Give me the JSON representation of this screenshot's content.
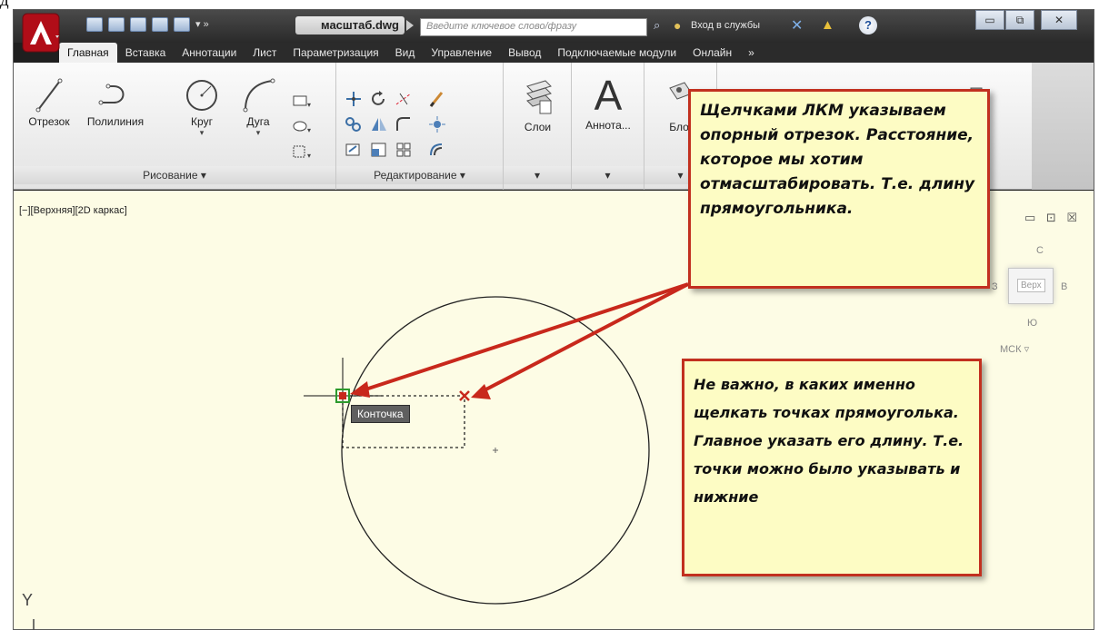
{
  "page_text_fragment": "д",
  "titlebar": {
    "document_title": "масштаб.dwg",
    "search_placeholder": "Введите ключевое слово/фразу",
    "signin_label": "Вход в службы",
    "help_label": "?"
  },
  "ribbon_tabs": [
    "Главная",
    "Вставка",
    "Аннотации",
    "Лист",
    "Параметризация",
    "Вид",
    "Управление",
    "Вывод",
    "Подключаемые модули",
    "Онлайн"
  ],
  "ribbon_tabs_overflow": "»",
  "active_tab": "Главная",
  "draw_panel": {
    "tools": [
      "Отрезок",
      "Полилиния",
      "Круг",
      "Дуга"
    ],
    "footer": "Рисование ▾"
  },
  "modify_panel": {
    "footer": "Редактирование ▾"
  },
  "layers": {
    "label": "Слои"
  },
  "annotation": {
    "label": "Аннота...",
    "glyph": "A"
  },
  "blocks": {
    "label": "Бло"
  },
  "viewport": {
    "label": "[−][Верхняя][2D каркас]",
    "controls": "▭ ⊡ ☒",
    "viewcube": {
      "north": "С",
      "south": "Ю",
      "west": "З",
      "east": "В",
      "face": "Верх"
    },
    "ucs": "МСК ▿",
    "tooltip": "Конточка",
    "y_axis": "Y"
  },
  "callouts": {
    "reference": "Щелчками ЛКМ указываем опорный отрезок. Расстояние, которое мы хотим отмасштабировать. Т.е. длину прямоугольника.",
    "note": "Не важно, в каких именно щелкать точках прямоуголька. Главное указать его длину. Т.е. точки можно было указывать и нижние"
  },
  "colors": {
    "callout_bg": "#fdfcc4",
    "callout_border": "#c2301f",
    "arrow": "#c8281c",
    "viewport_bg": "#fdfce5",
    "app_red": "#c8141e"
  }
}
